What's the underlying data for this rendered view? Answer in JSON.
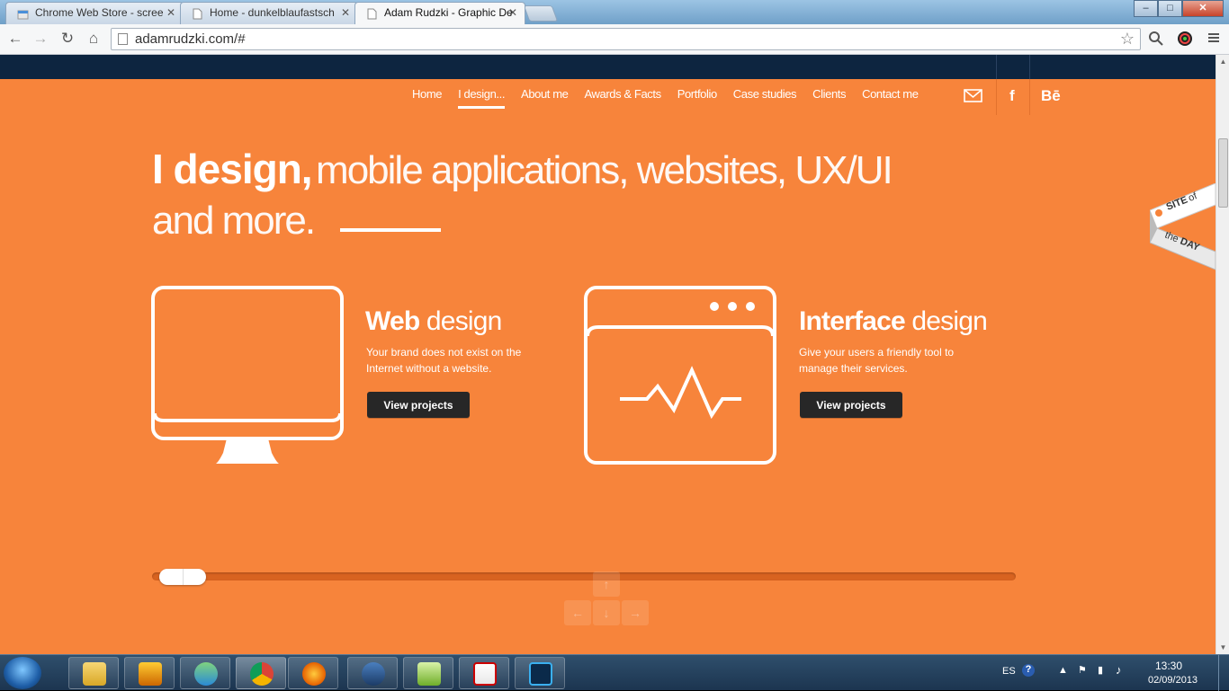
{
  "browser": {
    "tabs": [
      {
        "title": "Chrome Web Store - scree",
        "active": false
      },
      {
        "title": "Home - dunkelblaufastsch",
        "active": false
      },
      {
        "title": "Adam Rudzki - Graphic De",
        "active": true
      }
    ],
    "url": "adamrudzki.com/#",
    "window_controls": {
      "minimize": "–",
      "maximize": "□",
      "close": "✕"
    }
  },
  "site": {
    "nav": [
      "Home",
      "I design...",
      "About me",
      "Awards & Facts",
      "Portfolio",
      "Case studies",
      "Clients",
      "Contact me"
    ],
    "active_nav": 1,
    "social": {
      "facebook": "f",
      "behance": "Bē"
    },
    "headline": {
      "bold": "I design,",
      "light": "mobile applications, websites, UX/UI",
      "line2": "and more."
    },
    "services": [
      {
        "title_bold": "Web",
        "title_light": " design",
        "desc": "Your brand does not exist on the Internet without a website.",
        "button": "View projects"
      },
      {
        "title_bold": "Interface",
        "title_light": " design",
        "desc": "Give your users a friendly tool to manage their services.",
        "button": "View projects"
      }
    ],
    "badge": {
      "line1": "SITE",
      "line1b": "of",
      "line2a": "the",
      "line2b": "DAY"
    },
    "keys": {
      "up": "↑",
      "left": "←",
      "down": "↓",
      "right": "→"
    },
    "slider_position": 0
  },
  "taskbar": {
    "lang": "ES",
    "time": "13:30",
    "date": "02/09/2013"
  },
  "colors": {
    "accent": "#f7843b",
    "dark": "#0d2540",
    "button": "#272727"
  }
}
